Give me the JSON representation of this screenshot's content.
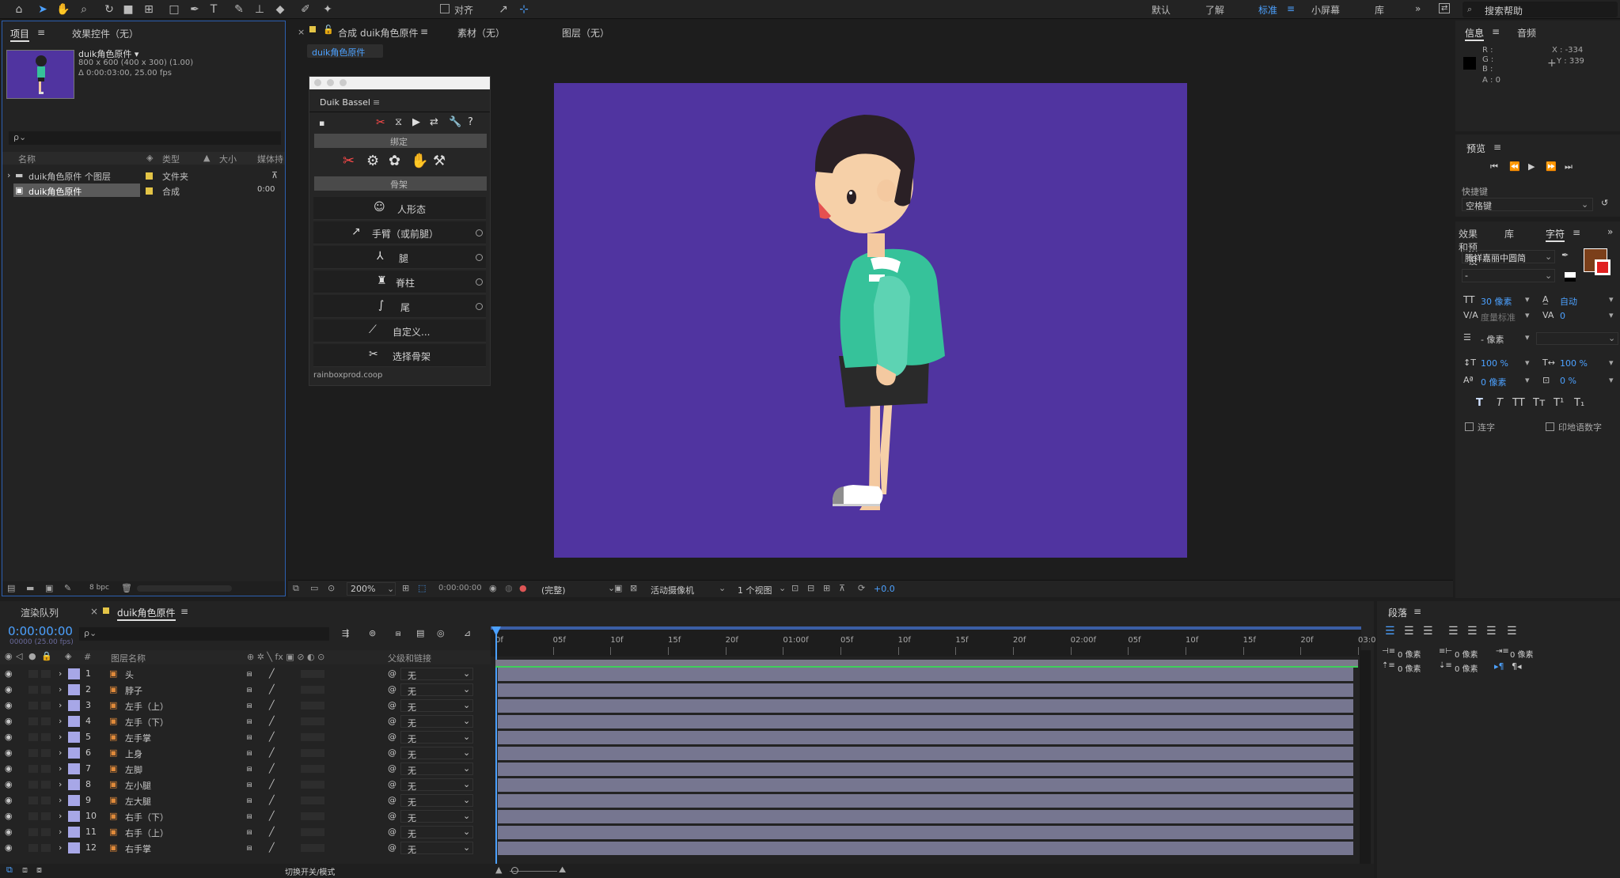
{
  "toolbar": {
    "snap_label": "对齐",
    "workspaces": [
      "默认",
      "了解",
      "标准",
      "小屏幕",
      "库"
    ],
    "active_workspace": "标准",
    "search_placeholder": "搜索帮助"
  },
  "project": {
    "tabs": [
      "项目",
      "效果控件（无）"
    ],
    "comp_name": "duik角色原件 ▾",
    "comp_size": "800 x 600  (400 x 300) (1.00)",
    "comp_duration": "Δ 0:00:03:00, 25.00 fps",
    "search_placeholder": "ρ⌄",
    "columns": [
      "名称",
      "类型",
      "大小",
      "媒体持"
    ],
    "items": [
      {
        "name": "duik角色原件 个图层",
        "type": "文件夹",
        "size": ""
      },
      {
        "name": "duik角色原件",
        "type": "合成",
        "size": "0:00"
      }
    ],
    "bpc": "8 bpc"
  },
  "comp_panel": {
    "tab_label": "合成",
    "tab_name": "duik角色原件",
    "tab_menu": "≡",
    "footage_tab": "素材（无）",
    "layer_tab": "图层（无）",
    "breadcrumb": "duik角色原件",
    "zoom": "200%",
    "timecode": "0:00:00:00",
    "resolution": "(完整)",
    "camera": "活动摄像机",
    "views": "1 个视图",
    "exposure": "+0.0",
    "canvas_color": "#5034a0"
  },
  "duik": {
    "title": "Duik Bassel",
    "section_bind": "绑定",
    "section_bones": "骨架",
    "buttons": [
      "人形态",
      "手臂（或前腿）",
      "腿",
      "脊柱",
      "尾",
      "自定义...",
      "选择骨架"
    ],
    "footer": "rainboxprod.coop"
  },
  "info": {
    "tabs": [
      "信息",
      "音频"
    ],
    "r": "R :",
    "g": "G :",
    "b": "B :",
    "a": "A : 0",
    "x": "X : -334",
    "y": "Y : 339"
  },
  "preview": {
    "title": "预览",
    "shortcut_label": "快捷键",
    "shortcut_value": "空格键"
  },
  "char": {
    "tabs": [
      "效果和预设",
      "库",
      "字符"
    ],
    "font": "腾祥嘉丽中圆简",
    "style": "-",
    "size": "30 像素",
    "leading": "自动",
    "kerning": "度量标准",
    "tracking": "0",
    "stroke": "- 像素",
    "vscale": "100 %",
    "hscale": "100 %",
    "baseline": "0 像素",
    "tsume": "0 %",
    "ligature": "连字",
    "hindi": "印地语数字",
    "fill_color": "#7b3f1a"
  },
  "paragraph": {
    "title": "段落",
    "vals": [
      "0 像素",
      "0 像素",
      "0 像素",
      "0 像素",
      "0 像素"
    ]
  },
  "timeline": {
    "tabs": [
      "渲染队列",
      "duik角色原件"
    ],
    "timecode": "0:00:00:00",
    "fps": "00000 (25.00 fps)",
    "search_placeholder": "ρ⌄",
    "col_num": "#",
    "col_name": "图层名称",
    "col_parent": "父级和链接",
    "toggle_label": "切换开关/模式",
    "ruler": [
      "0f",
      "05f",
      "10f",
      "15f",
      "20f",
      "01:00f",
      "05f",
      "10f",
      "15f",
      "20f",
      "02:00f",
      "05f",
      "10f",
      "15f",
      "20f",
      "03:0"
    ],
    "layers": [
      {
        "n": "1",
        "name": "头",
        "parent": "无"
      },
      {
        "n": "2",
        "name": "脖子",
        "parent": "无"
      },
      {
        "n": "3",
        "name": "左手（上）",
        "parent": "无"
      },
      {
        "n": "4",
        "name": "左手（下）",
        "parent": "无"
      },
      {
        "n": "5",
        "name": "左手掌",
        "parent": "无"
      },
      {
        "n": "6",
        "name": "上身",
        "parent": "无"
      },
      {
        "n": "7",
        "name": "左脚",
        "parent": "无"
      },
      {
        "n": "8",
        "name": "左小腿",
        "parent": "无"
      },
      {
        "n": "9",
        "name": "左大腿",
        "parent": "无"
      },
      {
        "n": "10",
        "name": "右手（下）",
        "parent": "无"
      },
      {
        "n": "11",
        "name": "右手（上）",
        "parent": "无"
      },
      {
        "n": "12",
        "name": "右手掌",
        "parent": "无"
      }
    ]
  }
}
